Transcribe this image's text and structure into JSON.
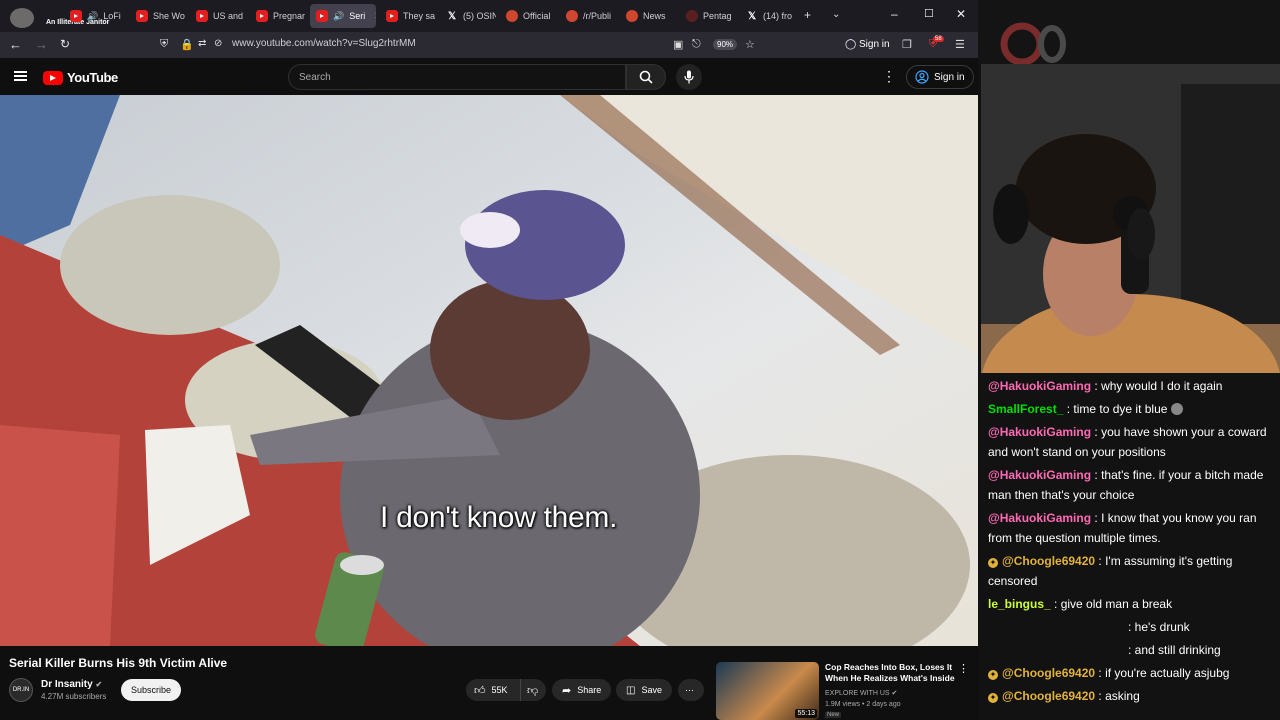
{
  "browser": {
    "overlay_title": "An Illiterate Janitor",
    "tabs": [
      {
        "label": "LoFi D",
        "icon": "youtube-icon"
      },
      {
        "label": "She Wo",
        "icon": "youtube-icon"
      },
      {
        "label": "US and",
        "icon": "youtube-icon"
      },
      {
        "label": "Pregnar",
        "icon": "youtube-icon"
      },
      {
        "label": "Seri",
        "icon": "youtube-icon",
        "active": true
      },
      {
        "label": "They sa",
        "icon": "youtube-icon"
      },
      {
        "label": "(5) OSIN",
        "icon": "x-icon"
      },
      {
        "label": "Official",
        "icon": "reddit-icon"
      },
      {
        "label": "/r/Publi",
        "icon": "reddit-icon"
      },
      {
        "label": "News",
        "icon": "reddit-icon"
      },
      {
        "label": "Pentag",
        "icon": "reddit-icon"
      },
      {
        "label": "(14) fro",
        "icon": "x-icon"
      }
    ],
    "url": "www.youtube.com/watch?v=Slug2rhtrMM",
    "zoom": "90%",
    "signin": "Sign in",
    "extension_badge": "58"
  },
  "youtube": {
    "logo_text": "YouTube",
    "search_placeholder": "Search",
    "signin": "Sign in",
    "caption": "I don't know them.",
    "video_title": "Serial Killer Burns His 9th Victim Alive",
    "channel": {
      "name": "Dr Insanity",
      "subscribers": "4.27M subscribers",
      "avatar_text": "DR.IN"
    },
    "subscribe": "Subscribe",
    "likes": "55K",
    "share": "Share",
    "save": "Save",
    "recommended": {
      "title": "Cop Reaches Into Box, Loses It When He Realizes What's Inside",
      "channel": "EXPLORE WITH US",
      "meta": "1.9M views • 2 days ago",
      "badge": "New",
      "duration": "55:13"
    }
  },
  "stream": {
    "chat": [
      {
        "user": "@HakuokiGaming",
        "color": "#ff69b4",
        "text": ": why would I do it again"
      },
      {
        "user": "SmallForest_",
        "color": "#00e000",
        "text": ": time to dye it blue"
      },
      {
        "user": "@HakuokiGaming",
        "color": "#ff69b4",
        "text": ": you have shown your a coward and won't stand on your positions"
      },
      {
        "user": "@HakuokiGaming",
        "color": "#ff69b4",
        "text": ": that's fine. if your a bitch made man then that's your choice"
      },
      {
        "user": "@HakuokiGaming",
        "color": "#ff69b4",
        "text": ": I know that you know you ran from the question multiple times."
      },
      {
        "user": "@Choogle69420",
        "color": "#e2b33c",
        "text": ": I'm assuming it's getting censored",
        "badge": true
      },
      {
        "user": "le_bingus_",
        "color": "#ccff33",
        "text": ": give old man a break"
      },
      {
        "user": "",
        "color": "#ffffff",
        "text": ": he's drunk"
      },
      {
        "user": "",
        "color": "#ffffff",
        "text": ": and still drinking"
      },
      {
        "user": "@Choogle69420",
        "color": "#e2b33c",
        "text": ": if you're actually asjubg",
        "badge": true
      },
      {
        "user": "@Choogle69420",
        "color": "#e2b33c",
        "text": ": asking",
        "badge": true
      }
    ]
  }
}
